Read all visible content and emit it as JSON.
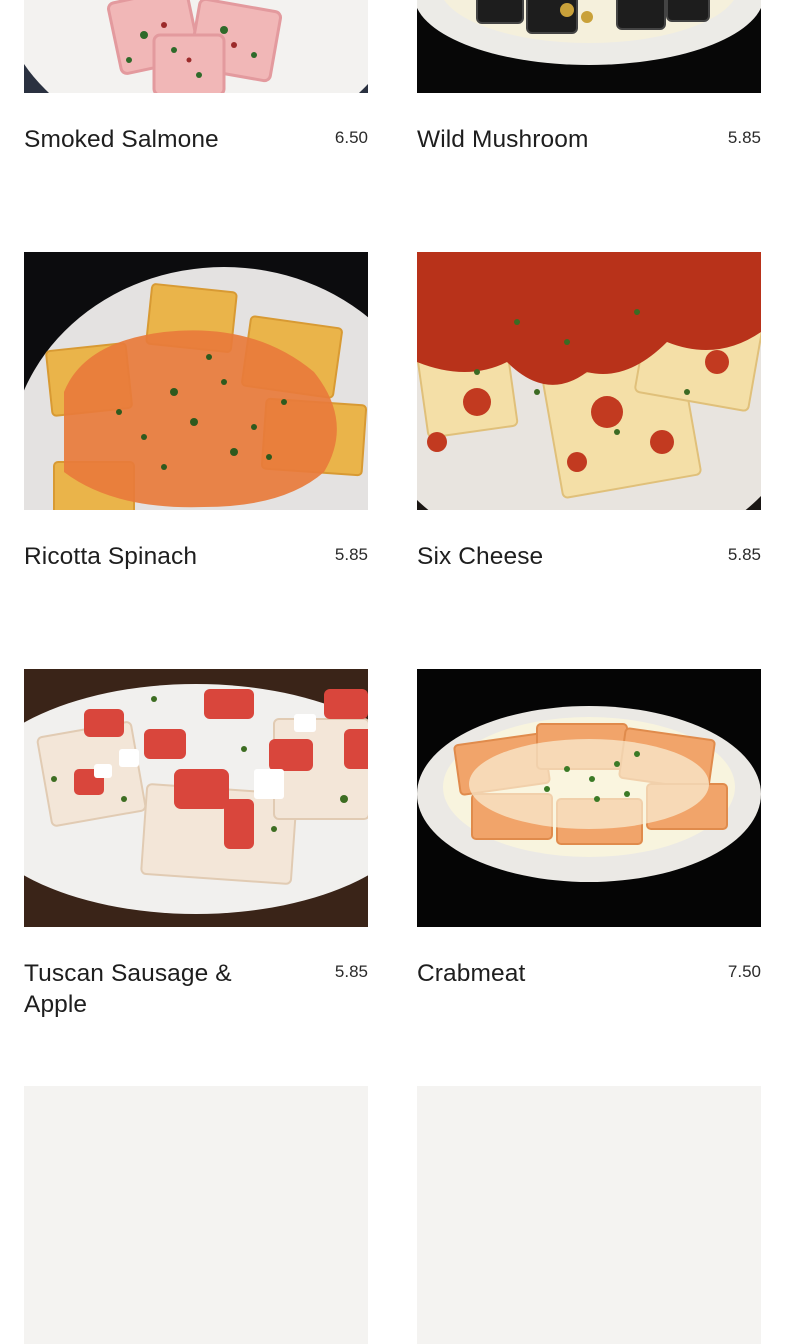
{
  "menu": {
    "items": [
      {
        "name": "Smoked Salmone",
        "price": "6.50",
        "image": "salmon-ravioli-photo"
      },
      {
        "name": "Wild Mushroom",
        "price": "5.85",
        "image": "mushroom-ravioli-photo"
      },
      {
        "name": "Ricotta Spinach",
        "price": "5.85",
        "image": "ricotta-spinach-ravioli-photo"
      },
      {
        "name": "Six Cheese",
        "price": "5.85",
        "image": "six-cheese-ravioli-photo"
      },
      {
        "name": "Tuscan Sausage & Apple",
        "price": "5.85",
        "image": "tuscan-sausage-ravioli-photo"
      },
      {
        "name": "Crabmeat",
        "price": "7.50",
        "image": "crabmeat-ravioli-photo"
      }
    ]
  },
  "colors": {
    "text": "#1e1e1e",
    "price": "#2a2a2a",
    "background": "#ffffff",
    "plate": "#e9e7e3",
    "tomato_sauce": "#c0371f",
    "vodka_sauce": "#e07a3a",
    "cream_sauce": "#f6f1d8"
  }
}
